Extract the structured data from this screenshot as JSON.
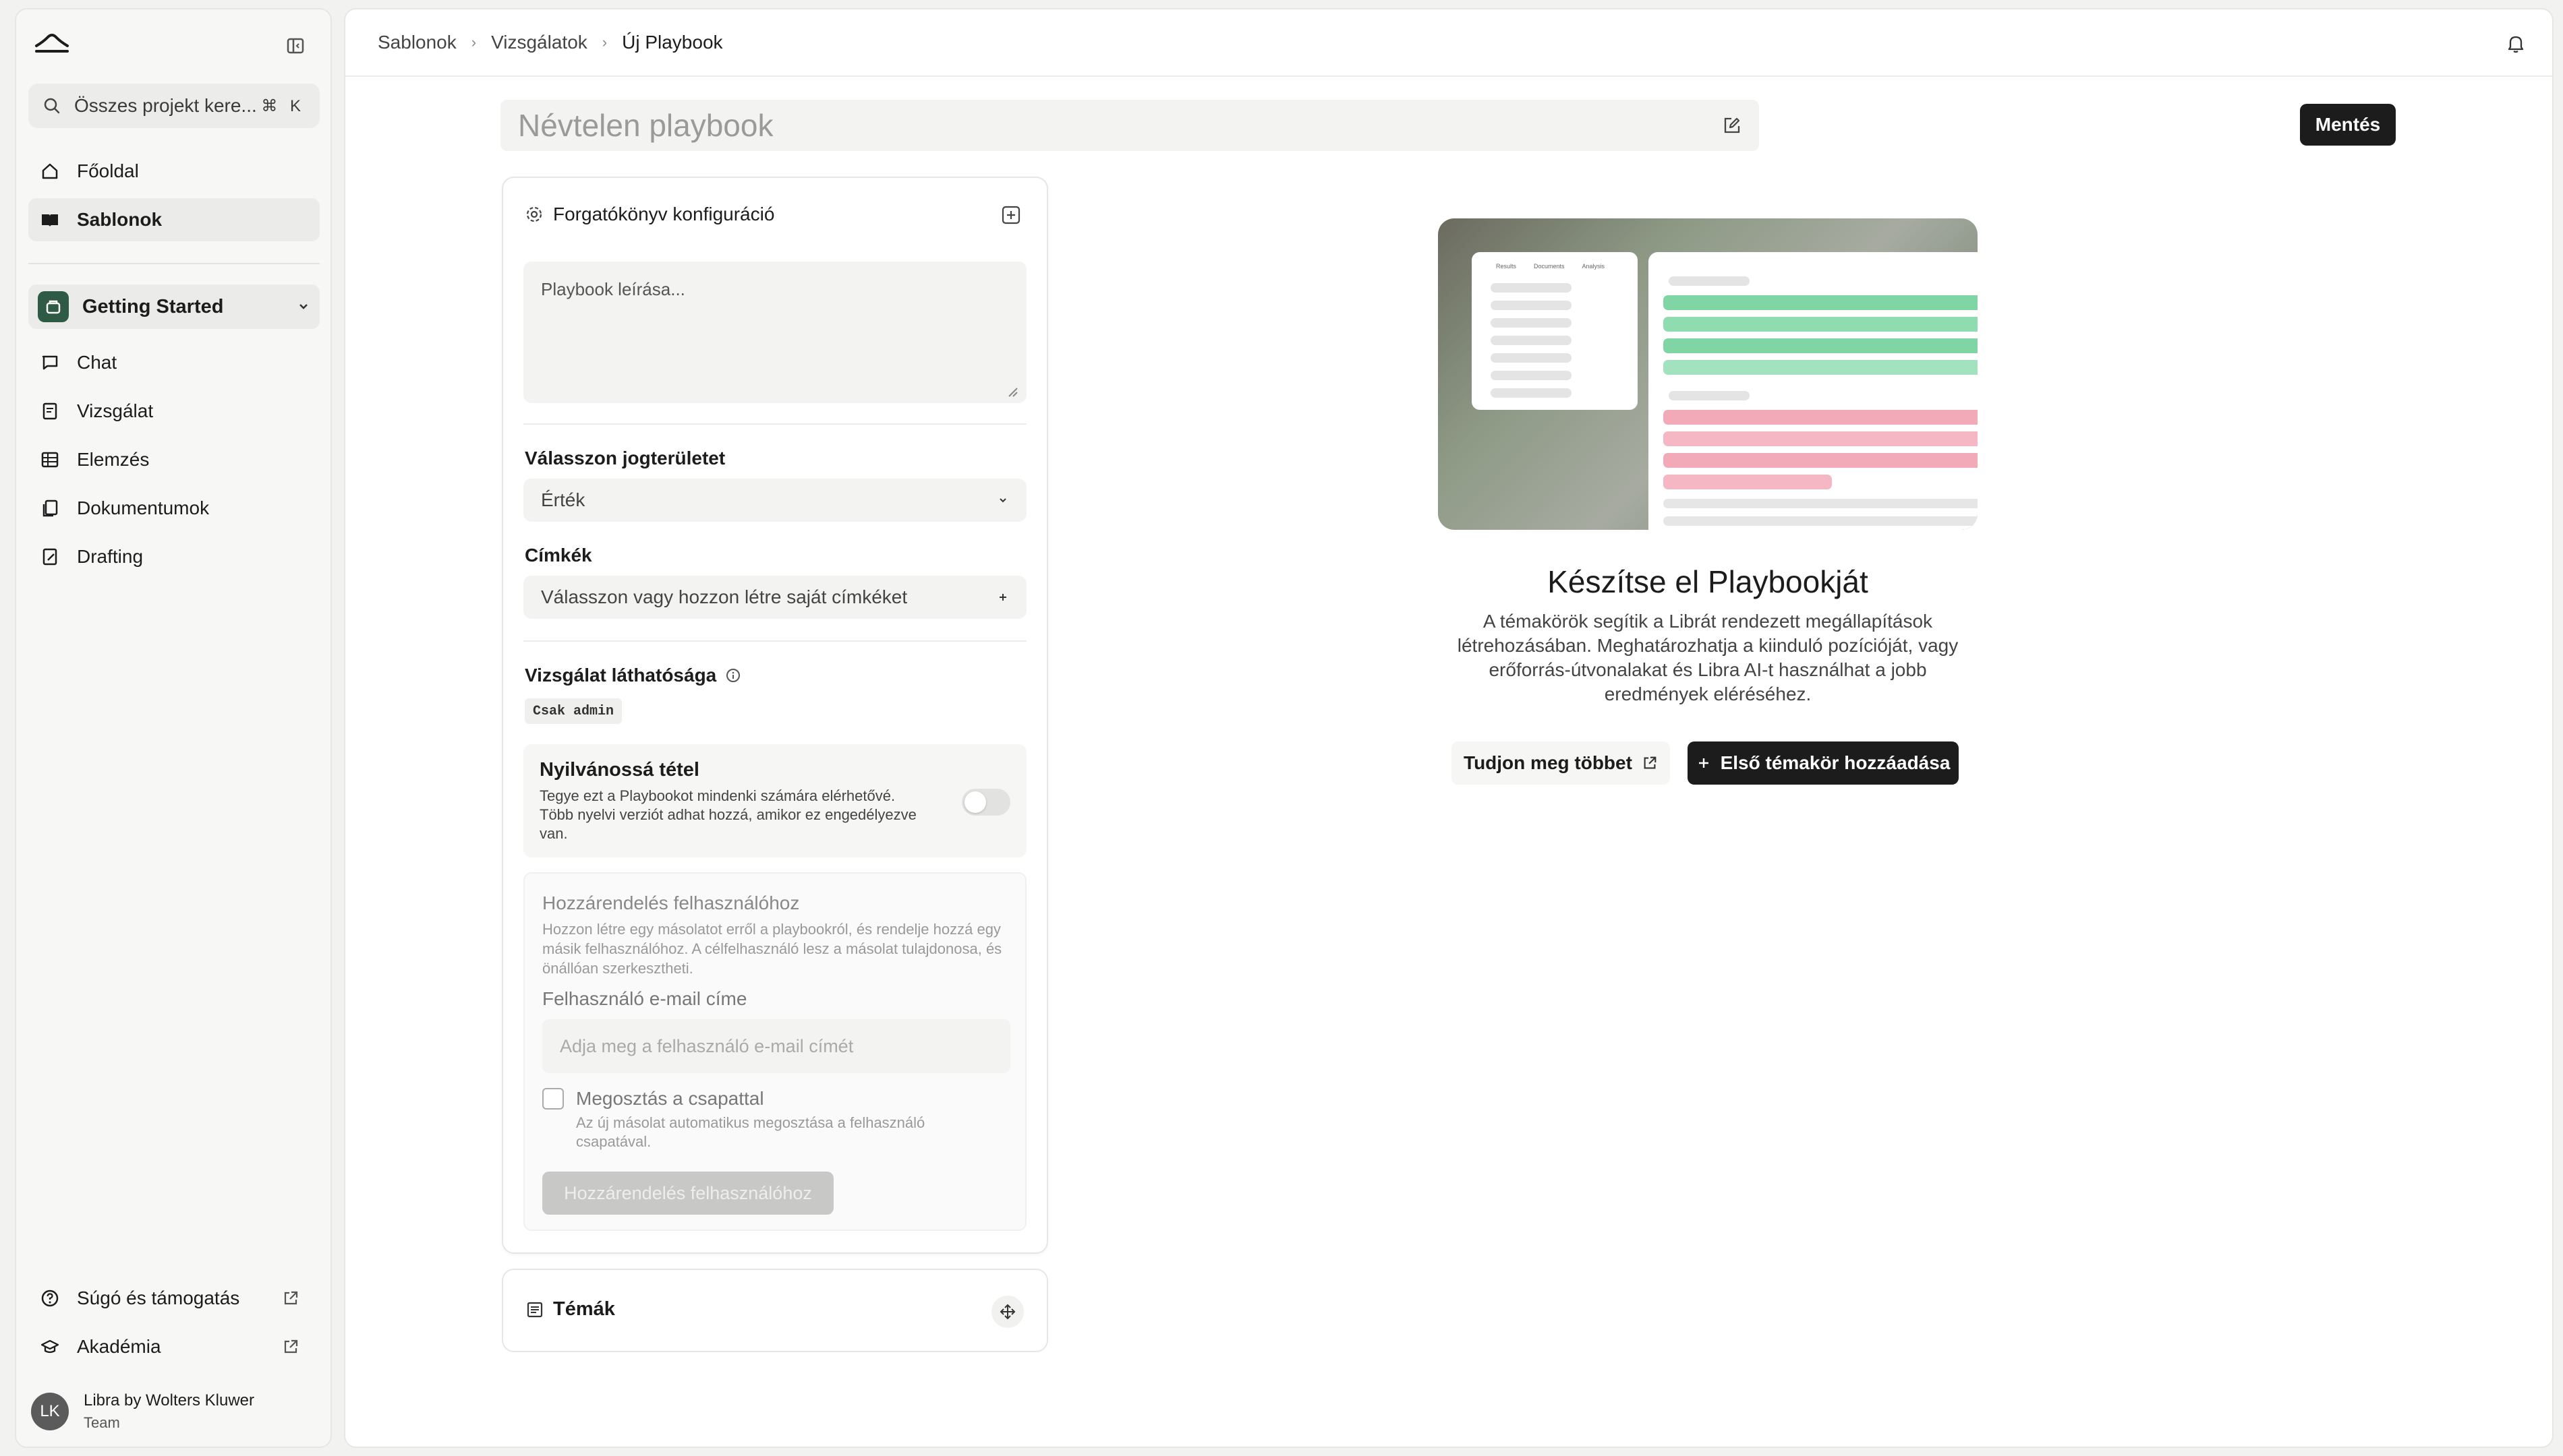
{
  "sidebar": {
    "search_placeholder": "Összes projekt kere...",
    "search_shortcut": "⌘ K",
    "nav": [
      {
        "label": "Főoldal",
        "icon": "home-icon"
      },
      {
        "label": "Sablonok",
        "icon": "book-icon",
        "active": true
      }
    ],
    "project": {
      "name": "Getting Started"
    },
    "project_nav": [
      {
        "label": "Chat",
        "icon": "chat-icon"
      },
      {
        "label": "Vizsgálat",
        "icon": "review-icon"
      },
      {
        "label": "Elemzés",
        "icon": "table-icon"
      },
      {
        "label": "Dokumentumok",
        "icon": "documents-icon"
      },
      {
        "label": "Drafting",
        "icon": "drafting-icon"
      }
    ],
    "footer": [
      {
        "label": "Súgó és támogatás",
        "icon": "help-icon"
      },
      {
        "label": "Akadémia",
        "icon": "academy-icon"
      }
    ],
    "user": {
      "initials": "LK",
      "name": "Libra by Wolters Kluwer",
      "role": "Team"
    }
  },
  "breadcrumb": [
    "Sablonok",
    "Vizsgálatok",
    "Új Playbook"
  ],
  "title_placeholder": "Névtelen playbook",
  "save_label": "Mentés",
  "config": {
    "heading": "Forgatókönyv konfiguráció",
    "description_placeholder": "Playbook leírása...",
    "jurisdiction_label": "Válasszon jogterületet",
    "jurisdiction_value": "Érték",
    "tags_label": "Címkék",
    "tags_placeholder": "Válasszon vagy hozzon létre saját címkéket",
    "visibility_label": "Vizsgálat láthatósága",
    "visibility_chip": "Csak admin",
    "public": {
      "title": "Nyilvánossá tétel",
      "desc": "Tegye ezt a Playbookot mindenki számára elérhetővé. Több nyelvi verziót adhat hozzá, amikor ez engedélyezve van.",
      "enabled": false
    },
    "assign": {
      "title": "Hozzárendelés felhasználóhoz",
      "desc": "Hozzon létre egy másolatot erről a playbookról, és rendelje hozzá egy másik felhasználóhoz. A célfelhasználó lesz a másolat tulajdonosa, és önállóan szerkesztheti.",
      "email_label": "Felhasználó e-mail címe",
      "email_placeholder": "Adja meg a felhasználó e-mail címét",
      "share_label": "Megosztás a csapattal",
      "share_desc": "Az új másolat automatikus megosztása a felhasználó csapatával.",
      "button": "Hozzárendelés felhasználóhoz"
    }
  },
  "topics_heading": "Témák",
  "empty_state": {
    "title": "Készítse el Playbookját",
    "desc": "A témakörök segítik a Librát rendezett megállapítások létrehozásában. Meghatározhatja a kiinduló pozícióját, vagy erőforrás-útvonalakat és Libra AI-t használhat a jobb eredmények eléréséhez.",
    "learn_more": "Tudjon meg többet",
    "add_first": "Első témakör hozzáadása",
    "illustration_tabs": [
      "Results",
      "Documents",
      "Analysis"
    ]
  },
  "colors": {
    "accent": "#1c1c1c",
    "project_badge": "#2f5a44",
    "green_bar": "#7fd6a4",
    "red_bar": "#f2a9b8"
  }
}
